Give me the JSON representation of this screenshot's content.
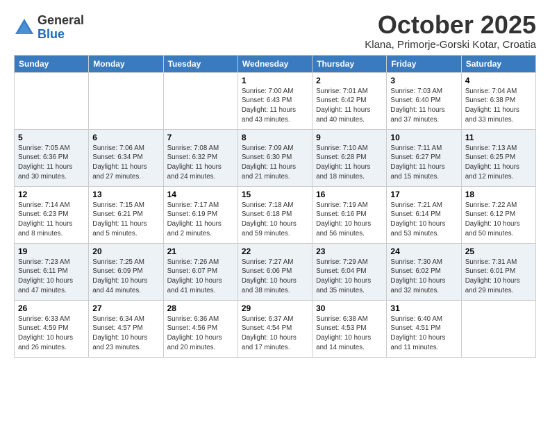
{
  "header": {
    "logo_general": "General",
    "logo_blue": "Blue",
    "month_title": "October 2025",
    "location": "Klana, Primorje-Gorski Kotar, Croatia"
  },
  "days_of_week": [
    "Sunday",
    "Monday",
    "Tuesday",
    "Wednesday",
    "Thursday",
    "Friday",
    "Saturday"
  ],
  "weeks": [
    [
      {
        "day": "",
        "info": ""
      },
      {
        "day": "",
        "info": ""
      },
      {
        "day": "",
        "info": ""
      },
      {
        "day": "1",
        "info": "Sunrise: 7:00 AM\nSunset: 6:43 PM\nDaylight: 11 hours\nand 43 minutes."
      },
      {
        "day": "2",
        "info": "Sunrise: 7:01 AM\nSunset: 6:42 PM\nDaylight: 11 hours\nand 40 minutes."
      },
      {
        "day": "3",
        "info": "Sunrise: 7:03 AM\nSunset: 6:40 PM\nDaylight: 11 hours\nand 37 minutes."
      },
      {
        "day": "4",
        "info": "Sunrise: 7:04 AM\nSunset: 6:38 PM\nDaylight: 11 hours\nand 33 minutes."
      }
    ],
    [
      {
        "day": "5",
        "info": "Sunrise: 7:05 AM\nSunset: 6:36 PM\nDaylight: 11 hours\nand 30 minutes."
      },
      {
        "day": "6",
        "info": "Sunrise: 7:06 AM\nSunset: 6:34 PM\nDaylight: 11 hours\nand 27 minutes."
      },
      {
        "day": "7",
        "info": "Sunrise: 7:08 AM\nSunset: 6:32 PM\nDaylight: 11 hours\nand 24 minutes."
      },
      {
        "day": "8",
        "info": "Sunrise: 7:09 AM\nSunset: 6:30 PM\nDaylight: 11 hours\nand 21 minutes."
      },
      {
        "day": "9",
        "info": "Sunrise: 7:10 AM\nSunset: 6:28 PM\nDaylight: 11 hours\nand 18 minutes."
      },
      {
        "day": "10",
        "info": "Sunrise: 7:11 AM\nSunset: 6:27 PM\nDaylight: 11 hours\nand 15 minutes."
      },
      {
        "day": "11",
        "info": "Sunrise: 7:13 AM\nSunset: 6:25 PM\nDaylight: 11 hours\nand 12 minutes."
      }
    ],
    [
      {
        "day": "12",
        "info": "Sunrise: 7:14 AM\nSunset: 6:23 PM\nDaylight: 11 hours\nand 8 minutes."
      },
      {
        "day": "13",
        "info": "Sunrise: 7:15 AM\nSunset: 6:21 PM\nDaylight: 11 hours\nand 5 minutes."
      },
      {
        "day": "14",
        "info": "Sunrise: 7:17 AM\nSunset: 6:19 PM\nDaylight: 11 hours\nand 2 minutes."
      },
      {
        "day": "15",
        "info": "Sunrise: 7:18 AM\nSunset: 6:18 PM\nDaylight: 10 hours\nand 59 minutes."
      },
      {
        "day": "16",
        "info": "Sunrise: 7:19 AM\nSunset: 6:16 PM\nDaylight: 10 hours\nand 56 minutes."
      },
      {
        "day": "17",
        "info": "Sunrise: 7:21 AM\nSunset: 6:14 PM\nDaylight: 10 hours\nand 53 minutes."
      },
      {
        "day": "18",
        "info": "Sunrise: 7:22 AM\nSunset: 6:12 PM\nDaylight: 10 hours\nand 50 minutes."
      }
    ],
    [
      {
        "day": "19",
        "info": "Sunrise: 7:23 AM\nSunset: 6:11 PM\nDaylight: 10 hours\nand 47 minutes."
      },
      {
        "day": "20",
        "info": "Sunrise: 7:25 AM\nSunset: 6:09 PM\nDaylight: 10 hours\nand 44 minutes."
      },
      {
        "day": "21",
        "info": "Sunrise: 7:26 AM\nSunset: 6:07 PM\nDaylight: 10 hours\nand 41 minutes."
      },
      {
        "day": "22",
        "info": "Sunrise: 7:27 AM\nSunset: 6:06 PM\nDaylight: 10 hours\nand 38 minutes."
      },
      {
        "day": "23",
        "info": "Sunrise: 7:29 AM\nSunset: 6:04 PM\nDaylight: 10 hours\nand 35 minutes."
      },
      {
        "day": "24",
        "info": "Sunrise: 7:30 AM\nSunset: 6:02 PM\nDaylight: 10 hours\nand 32 minutes."
      },
      {
        "day": "25",
        "info": "Sunrise: 7:31 AM\nSunset: 6:01 PM\nDaylight: 10 hours\nand 29 minutes."
      }
    ],
    [
      {
        "day": "26",
        "info": "Sunrise: 6:33 AM\nSunset: 4:59 PM\nDaylight: 10 hours\nand 26 minutes."
      },
      {
        "day": "27",
        "info": "Sunrise: 6:34 AM\nSunset: 4:57 PM\nDaylight: 10 hours\nand 23 minutes."
      },
      {
        "day": "28",
        "info": "Sunrise: 6:36 AM\nSunset: 4:56 PM\nDaylight: 10 hours\nand 20 minutes."
      },
      {
        "day": "29",
        "info": "Sunrise: 6:37 AM\nSunset: 4:54 PM\nDaylight: 10 hours\nand 17 minutes."
      },
      {
        "day": "30",
        "info": "Sunrise: 6:38 AM\nSunset: 4:53 PM\nDaylight: 10 hours\nand 14 minutes."
      },
      {
        "day": "31",
        "info": "Sunrise: 6:40 AM\nSunset: 4:51 PM\nDaylight: 10 hours\nand 11 minutes."
      },
      {
        "day": "",
        "info": ""
      }
    ]
  ]
}
